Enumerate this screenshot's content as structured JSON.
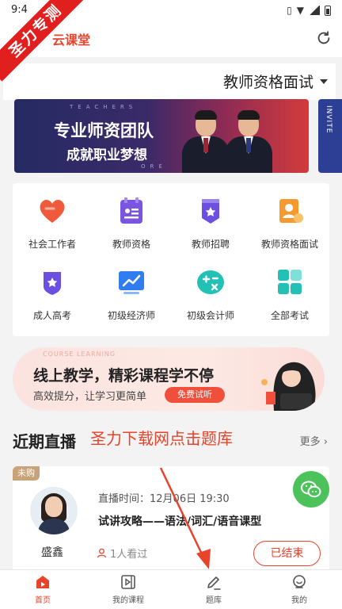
{
  "status_bar": {
    "time": "9:4"
  },
  "ribbon": {
    "text": "圣力专测"
  },
  "header": {
    "title": "云课堂"
  },
  "exam_selector": {
    "label": "教师资格面试"
  },
  "banner": {
    "line1": "专业师资团队",
    "line2": "成就职业梦想",
    "deco_top": "TEACHERS",
    "deco_bottom": "ORE",
    "next_text": "INVITE"
  },
  "categories": [
    {
      "label": "社会工作者",
      "icon": "heart-icon",
      "color": "#ef5a3c"
    },
    {
      "label": "教师资格",
      "icon": "id-card-icon",
      "color": "#7a56e0"
    },
    {
      "label": "教师招聘",
      "icon": "badge-star-icon",
      "color": "#6a4fe0"
    },
    {
      "label": "教师资格面试",
      "icon": "person-card-icon",
      "color": "#f59a2e"
    },
    {
      "label": "成人高考",
      "icon": "shield-star-icon",
      "color": "#6a4fe0"
    },
    {
      "label": "初级经济师",
      "icon": "trend-chart-icon",
      "color": "#2f7df0"
    },
    {
      "label": "初级会计师",
      "icon": "calculator-icon",
      "color": "#22c0b5"
    },
    {
      "label": "全部考试",
      "icon": "grid-icon",
      "color": "#22c0b5"
    }
  ],
  "promo": {
    "small_text": "COURSE LEARNING",
    "title": "线上教学，精彩课程学不停",
    "subtitle": "高效提分，让学习更简单",
    "button": "免费试听"
  },
  "live_section": {
    "title": "近期直播",
    "overlay_note": "圣力下载网点击题库",
    "more": "更多"
  },
  "live_card": {
    "tag": "未购",
    "teacher": "盛鑫",
    "time": "直播时间：12月06日 19:30",
    "title": "试讲攻略——语法/词汇/语音课型",
    "viewers": "1人看过",
    "status_button": "已结束"
  },
  "tabbar": {
    "items": [
      {
        "label": "首页",
        "icon": "home-play-icon",
        "active": true
      },
      {
        "label": "我的课程",
        "icon": "course-icon",
        "active": false
      },
      {
        "label": "题库",
        "icon": "pencil-icon",
        "active": false
      },
      {
        "label": "我的",
        "icon": "user-icon",
        "active": false
      }
    ]
  },
  "colors": {
    "accent": "#e8432b",
    "wechat": "#4cc35a"
  }
}
